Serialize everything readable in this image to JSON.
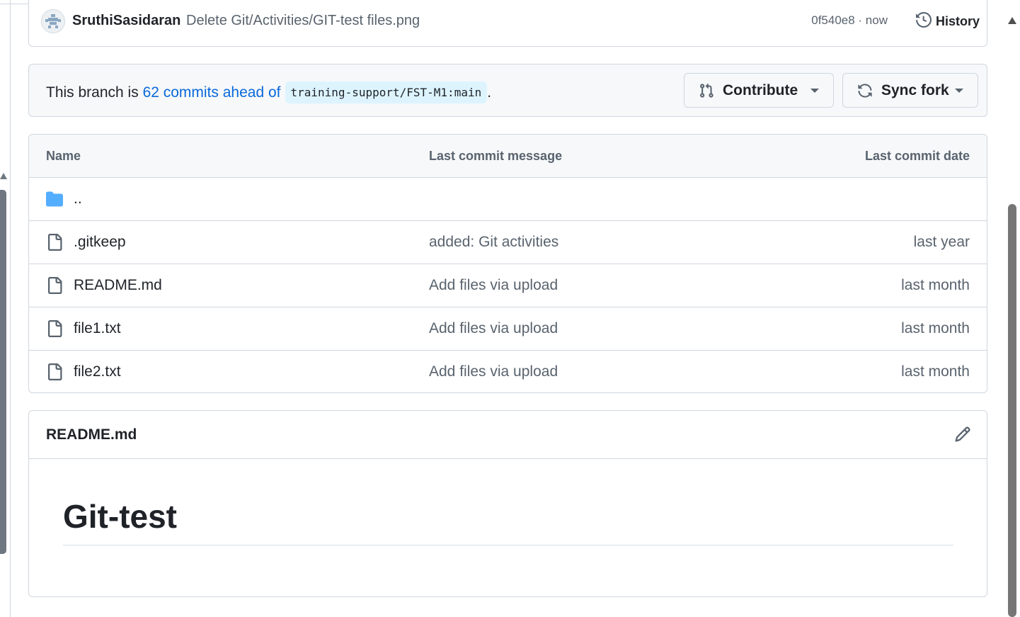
{
  "commit": {
    "author": "SruthiSasidaran",
    "message": "Delete Git/Activities/GIT-test files.png",
    "sha_time": "0f540e8 · now",
    "history_label": "History"
  },
  "branch": {
    "prefix": "This branch is ",
    "link": "62 commits ahead of",
    "ref": "training-support/FST-M1:main",
    "suffix": ".",
    "contribute_label": "Contribute",
    "sync_label": "Sync fork"
  },
  "table": {
    "headers": {
      "name": "Name",
      "message": "Last commit message",
      "date": "Last commit date"
    },
    "parent_dir": "..",
    "rows": [
      {
        "name": ".gitkeep",
        "message": "added: Git activities",
        "date": "last year"
      },
      {
        "name": "README.md",
        "message": "Add files via upload",
        "date": "last month"
      },
      {
        "name": "file1.txt",
        "message": "Add files via upload",
        "date": "last month"
      },
      {
        "name": "file2.txt",
        "message": "Add files via upload",
        "date": "last month"
      }
    ]
  },
  "readme": {
    "title": "README.md",
    "heading": "Git-test"
  },
  "colors": {
    "link": "#0969da",
    "folder": "#54aeff",
    "border": "#d0d7de",
    "muted": "#59636e"
  }
}
